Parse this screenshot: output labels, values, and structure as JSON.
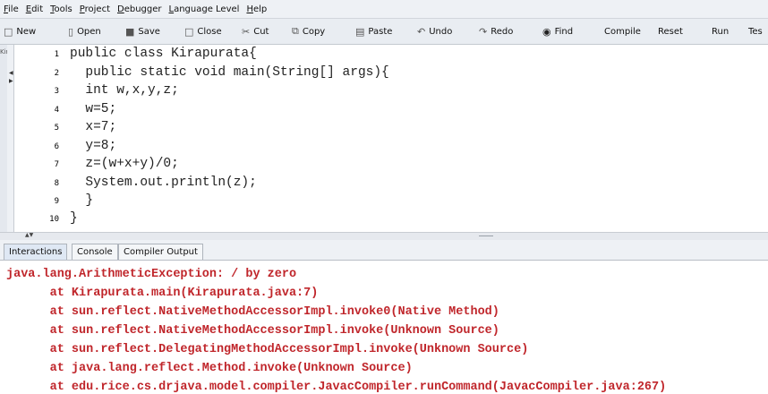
{
  "menubar": {
    "items": [
      {
        "key": "F",
        "rest": "ile"
      },
      {
        "key": "E",
        "rest": "dit"
      },
      {
        "key": "T",
        "rest": "ools"
      },
      {
        "key": "P",
        "rest": "roject"
      },
      {
        "key": "D",
        "rest": "ebugger"
      },
      {
        "key": "L",
        "rest": "anguage Level"
      },
      {
        "key": "H",
        "rest": "elp"
      }
    ]
  },
  "toolbar": {
    "new_label": "New",
    "open_label": "Open",
    "save_label": "Save",
    "close_label": "Close",
    "cut_label": "Cut",
    "copy_label": "Copy",
    "paste_label": "Paste",
    "undo_label": "Undo",
    "redo_label": "Redo",
    "find_label": "Find",
    "compile_label": "Compile",
    "reset_label": "Reset",
    "run_label": "Run",
    "test_label": "Tes"
  },
  "editor": {
    "tree_label": "Kir",
    "line_numbers": [
      "1",
      "2",
      "3",
      "4",
      "5",
      "6",
      "7",
      "8",
      "9",
      "10"
    ],
    "lines": [
      "public class Kirapurata{",
      "  public static void main(String[] args){",
      "  int w,x,y,z;",
      "  w=5;",
      "  x=7;",
      "  y=8;",
      "  z=(w+x+y)/0;",
      "  System.out.println(z);",
      "  }",
      "}"
    ]
  },
  "tabs": {
    "interactions": "Interactions",
    "console": "Console",
    "compiler_output": "Compiler Output"
  },
  "output": {
    "lines": [
      "java.lang.ArithmeticException: / by zero",
      "      at Kirapurata.main(Kirapurata.java:7)",
      "      at sun.reflect.NativeMethodAccessorImpl.invoke0(Native Method)",
      "      at sun.reflect.NativeMethodAccessorImpl.invoke(Unknown Source)",
      "      at sun.reflect.DelegatingMethodAccessorImpl.invoke(Unknown Source)",
      "      at java.lang.reflect.Method.invoke(Unknown Source)",
      "      at edu.rice.cs.drjava.model.compiler.JavacCompiler.runCommand(JavacCompiler.java:267)"
    ]
  },
  "colors": {
    "error_text": "#c0262b",
    "code_text": "#222222"
  }
}
